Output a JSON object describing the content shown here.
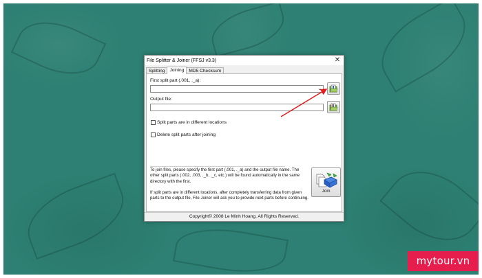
{
  "window": {
    "title": "File Splitter & Joiner (FFSJ v3.3)",
    "close_glyph": "✕"
  },
  "tabs": [
    {
      "label": "Splitting",
      "active": false
    },
    {
      "label": "Joining",
      "active": true
    },
    {
      "label": "MD5 Checksum",
      "active": false
    }
  ],
  "joining": {
    "first_part_label": "First split part (.001, ._a):",
    "first_part_value": "",
    "output_label": "Output file:",
    "output_value": "",
    "checkbox_locations": "Split parts are in different locations",
    "checkbox_delete": "Delete split parts after joining",
    "info_paragraph_1": "To join files, please specify the first part (.001, ._a) and the output file name. The other split parts (.002, .003, ._b, ._c, etc.) will be found automatically in the same directory with the first.",
    "info_paragraph_2": "If split parts are in different locations, after completely transferring data from given parts to the output file, File Joiner will ask you to provide next parts before continuing.",
    "join_button_label": "Join"
  },
  "statusbar": {
    "text": "Copyright© 2008 Le Minh Hoang. All Rights Reserved."
  },
  "icons": {
    "browse_open": "folder-open-icon",
    "browse_save": "folder-save-icon",
    "join": "join-files-icon"
  },
  "colors": {
    "background": "#2d8073",
    "annotation_arrow": "#e02020",
    "brand": "#e61e4d"
  },
  "watermark": {
    "text": "mytour.vn"
  }
}
